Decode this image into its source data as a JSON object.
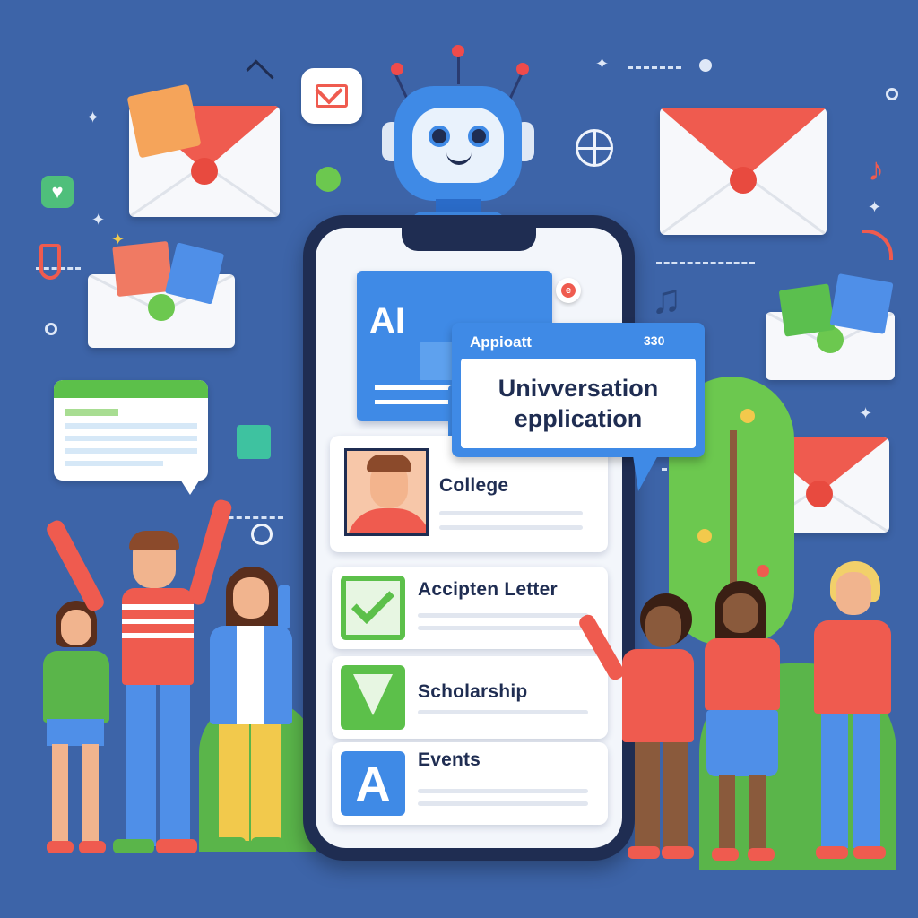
{
  "ai_card": {
    "title": "AI",
    "badge": "e"
  },
  "popup": {
    "tag": "Appioatt",
    "tag_num": "330",
    "title_line1": "Univversation",
    "title_line2": "epplication"
  },
  "list": [
    {
      "label": "College",
      "icon": "student-avatar-icon"
    },
    {
      "label": "Accipten Letter",
      "icon": "check-tile-icon"
    },
    {
      "label": "Scholarship",
      "icon": "v-check-tile-icon"
    },
    {
      "label": "Events",
      "icon": "letter-a-tile-icon"
    }
  ],
  "colors": {
    "background": "#3d64a8",
    "phone_frame": "#1f2d52",
    "accent_blue": "#3f8ae6",
    "envelope_red": "#ef5b4f",
    "check_green": "#5cc04a",
    "shirt_coral": "#f25c4c"
  }
}
